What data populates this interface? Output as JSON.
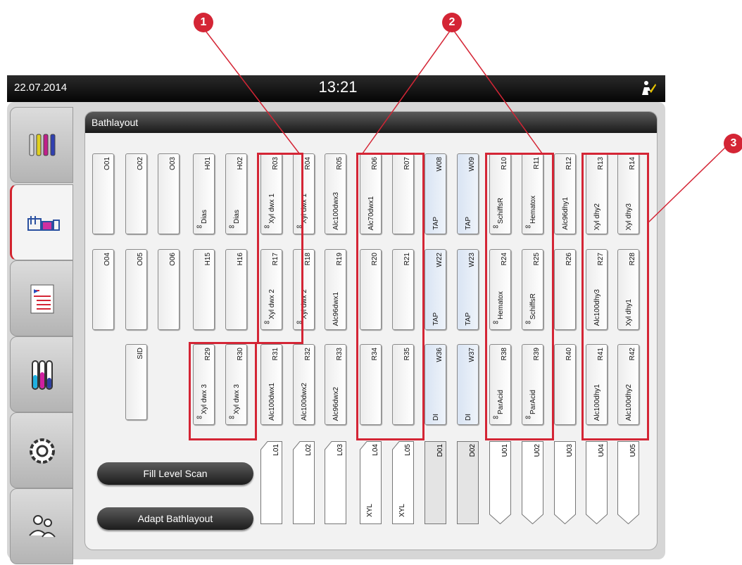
{
  "topbar": {
    "date": "22.07.2014",
    "time": "13:21",
    "user_icon": "supervisor-user-icon"
  },
  "sidebar": {
    "tabs": [
      {
        "name": "programs",
        "icon": "staining-programs-icon"
      },
      {
        "name": "bathlayout",
        "icon": "bathlayout-icon",
        "active": true
      },
      {
        "name": "reagents",
        "icon": "reagent-list-icon"
      },
      {
        "name": "status",
        "icon": "reagent-status-icon"
      },
      {
        "name": "settings",
        "icon": "gear-icon"
      },
      {
        "name": "user",
        "icon": "user-settings-icon"
      }
    ]
  },
  "panel": {
    "title": "Bathlayout"
  },
  "baths": [
    {
      "id": "O01"
    },
    {
      "id": "O02"
    },
    {
      "id": "O03"
    },
    {
      "id": "H01",
      "reagent": "Dias",
      "infinity": "∞"
    },
    {
      "id": "H02",
      "reagent": "Dias",
      "infinity": "∞"
    },
    {
      "id": "R03",
      "reagent": "Xyl dwx 1",
      "infinity": "∞"
    },
    {
      "id": "R04",
      "reagent": "Xyl dwx 1",
      "infinity": "∞"
    },
    {
      "id": "R05",
      "reagent": "Alc100dwx3"
    },
    {
      "id": "R06",
      "reagent": "Alc70dwx1"
    },
    {
      "id": "R07"
    },
    {
      "id": "W08",
      "reagent": "TAP"
    },
    {
      "id": "W09",
      "reagent": "TAP"
    },
    {
      "id": "R10",
      "reagent": "SchiffsR",
      "infinity": "∞"
    },
    {
      "id": "R11",
      "reagent": "Hematox",
      "infinity": "∞"
    },
    {
      "id": "R12",
      "reagent": "Alc96dhy1"
    },
    {
      "id": "R13",
      "reagent": "Xyl dhy2"
    },
    {
      "id": "R14",
      "reagent": "Xyl dhy3"
    },
    {
      "id": "O04"
    },
    {
      "id": "O05"
    },
    {
      "id": "O06"
    },
    {
      "id": "H15"
    },
    {
      "id": "H16"
    },
    {
      "id": "R17",
      "reagent": "Xyl dwx 2",
      "infinity": "∞"
    },
    {
      "id": "R18",
      "reagent": "Xyl dwx 2",
      "infinity": "∞"
    },
    {
      "id": "R19",
      "reagent": "Alc96dwx1"
    },
    {
      "id": "R20"
    },
    {
      "id": "R21"
    },
    {
      "id": "W22",
      "reagent": "TAP"
    },
    {
      "id": "W23",
      "reagent": "TAP"
    },
    {
      "id": "R24",
      "reagent": "Hematox",
      "infinity": "∞"
    },
    {
      "id": "R25",
      "reagent": "SchiffsR",
      "infinity": "∞"
    },
    {
      "id": "R26"
    },
    {
      "id": "R27",
      "reagent": "Alc100dhy3"
    },
    {
      "id": "R28",
      "reagent": "Xyl dhy1"
    },
    {
      "id": "SID"
    },
    {
      "id": "R29",
      "reagent": "Xyl dwx 3",
      "infinity": "∞"
    },
    {
      "id": "R30",
      "reagent": "Xyl dwx 3",
      "infinity": "∞"
    },
    {
      "id": "R31",
      "reagent": "Alc100dwx1"
    },
    {
      "id": "R32",
      "reagent": "Alc100dwx2"
    },
    {
      "id": "R33",
      "reagent": "Alc96dwx2"
    },
    {
      "id": "R34"
    },
    {
      "id": "R35"
    },
    {
      "id": "W36",
      "reagent": "DI"
    },
    {
      "id": "W37",
      "reagent": "DI"
    },
    {
      "id": "R38",
      "reagent": "ParAcid",
      "infinity": "∞"
    },
    {
      "id": "R39",
      "reagent": "ParAcid",
      "infinity": "∞"
    },
    {
      "id": "R40"
    },
    {
      "id": "R41",
      "reagent": "Alc100dhy1"
    },
    {
      "id": "R42",
      "reagent": "Alc100dhy2"
    }
  ],
  "stations": [
    {
      "id": "L01"
    },
    {
      "id": "L02"
    },
    {
      "id": "L03"
    },
    {
      "id": "L04",
      "reagent": "XYL"
    },
    {
      "id": "L05",
      "reagent": "XYL"
    },
    {
      "id": "D01"
    },
    {
      "id": "D02"
    },
    {
      "id": "U01"
    },
    {
      "id": "U02"
    },
    {
      "id": "U03"
    },
    {
      "id": "U04"
    },
    {
      "id": "U05"
    }
  ],
  "buttons": {
    "fill_level_scan": "Fill Level Scan",
    "adapt_bathlayout": "Adapt Bathlayout"
  },
  "callouts": [
    "1",
    "2",
    "3"
  ],
  "colors": {
    "accent_red": "#d42535",
    "water_blue": "#d9e4f3"
  }
}
